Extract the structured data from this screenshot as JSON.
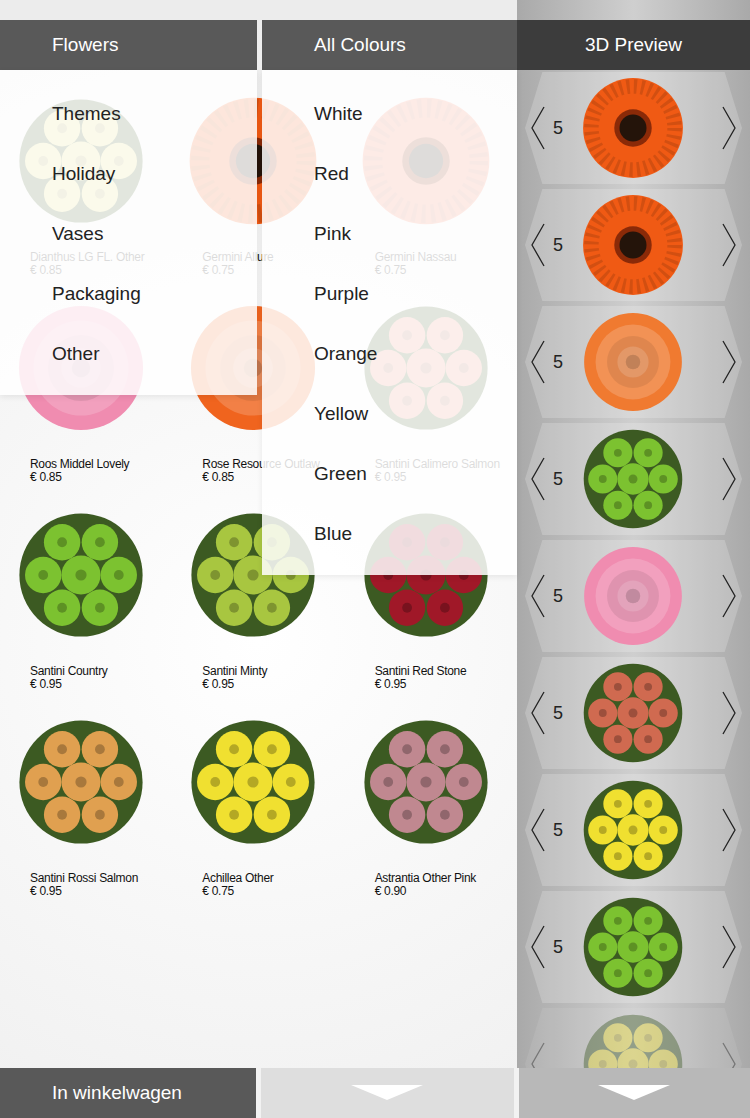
{
  "category_menu": {
    "label": "Flowers",
    "expanded": true,
    "options": [
      "Themes",
      "Holiday",
      "Vases",
      "Packaging",
      "Other"
    ]
  },
  "colour_menu": {
    "label": "All Colours",
    "expanded": true,
    "options": [
      "White",
      "Red",
      "Pink",
      "Purple",
      "Orange",
      "Yellow",
      "Green",
      "Blue"
    ]
  },
  "products": [
    {
      "name": "Dianthus LG FL. Other",
      "price": "€ 0.85",
      "kind": "cluster",
      "color": "#e6de78"
    },
    {
      "name": "Germini Allure",
      "price": "€ 0.75",
      "kind": "gerbera",
      "color": "#f05a14"
    },
    {
      "name": "Germini Nassau",
      "price": "€ 0.75",
      "kind": "gerbera",
      "color": "#f07a5a"
    },
    {
      "name": "Roos Middel Lovely",
      "price": "€ 0.85",
      "kind": "rose",
      "color": "#f08cb0"
    },
    {
      "name": "Rose Resource Outlaw",
      "price": "€ 0.85",
      "kind": "rose",
      "color": "#f0641e"
    },
    {
      "name": "Santini Calimero Salmon",
      "price": "€ 0.95",
      "kind": "cluster",
      "color": "#e8907a"
    },
    {
      "name": "Santini Country",
      "price": "€ 0.95",
      "kind": "cluster",
      "color": "#7cc230"
    },
    {
      "name": "Santini Minty",
      "price": "€ 0.95",
      "kind": "cluster",
      "color": "#a8c640"
    },
    {
      "name": "Santini Red Stone",
      "price": "€ 0.95",
      "kind": "cluster",
      "color": "#a01828"
    },
    {
      "name": "Santini Rossi Salmon",
      "price": "€ 0.95",
      "kind": "cluster",
      "color": "#e0a050"
    },
    {
      "name": "Achillea Other",
      "price": "€ 0.75",
      "kind": "cluster",
      "color": "#f0e030"
    },
    {
      "name": "Astrantia Other Pink",
      "price": "€ 0.90",
      "kind": "cluster",
      "color": "#c08890"
    }
  ],
  "preview": {
    "title": "3D Preview",
    "items": [
      {
        "count": "5",
        "kind": "gerbera",
        "color": "#f05a14",
        "faded": false
      },
      {
        "count": "5",
        "kind": "gerbera",
        "color": "#f05a14",
        "faded": false
      },
      {
        "count": "5",
        "kind": "rose",
        "color": "#f07a30",
        "faded": false
      },
      {
        "count": "5",
        "kind": "cluster",
        "color": "#7cc230",
        "faded": false
      },
      {
        "count": "5",
        "kind": "rose",
        "color": "#f08cb0",
        "faded": false
      },
      {
        "count": "5",
        "kind": "cluster",
        "color": "#d06a50",
        "faded": false
      },
      {
        "count": "5",
        "kind": "cluster",
        "color": "#f0e030",
        "faded": false
      },
      {
        "count": "5",
        "kind": "cluster",
        "color": "#7cc230",
        "faded": false
      },
      {
        "kind": "cluster",
        "color": "#f0e030",
        "faded": true
      }
    ]
  },
  "footer": {
    "cart_button": "In winkelwagen"
  }
}
